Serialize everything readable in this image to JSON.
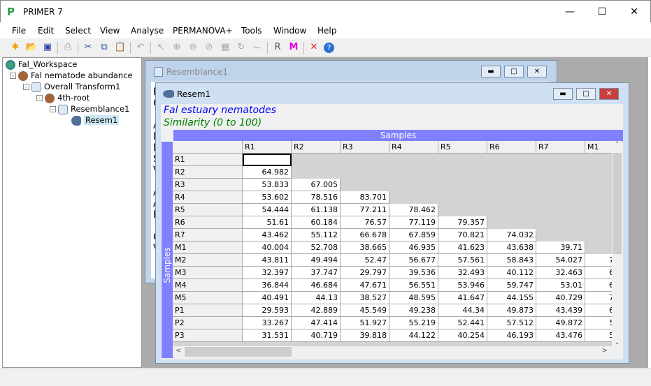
{
  "app": {
    "title": "PRIMER 7",
    "controls": [
      "minimize",
      "maximize",
      "close"
    ]
  },
  "menu": [
    "File",
    "Edit",
    "Select",
    "View",
    "Analyse",
    "PERMANOVA+",
    "Tools",
    "Window",
    "Help"
  ],
  "toolbar": [
    "new-icon",
    "open-icon",
    "save-icon",
    "print-icon",
    "cut-icon",
    "copy-icon",
    "paste-icon",
    "undo-icon",
    "pointer-icon",
    "zoom-in-icon",
    "zoom-out-icon",
    "zoom-reset-icon",
    "select-area-icon",
    "rotate-icon",
    "crop-icon",
    "matrix-r-icon",
    "matrix-m-icon",
    "delete-icon",
    "help-icon"
  ],
  "tree": [
    {
      "label": "Fal_Workspace",
      "icon": "globe-icon"
    },
    {
      "label": "Fal nematode abundance",
      "icon": "nematode-icon"
    },
    {
      "label": "Overall Transform1",
      "icon": "notepad-icon"
    },
    {
      "label": "4th-root",
      "icon": "nematode-icon"
    },
    {
      "label": "Resemblance1",
      "icon": "notepad-icon"
    },
    {
      "label": "Resem1",
      "icon": "fish-icon",
      "selected": true
    }
  ],
  "back_window": {
    "title": "Resemblance1",
    "edge_letters": [
      "R",
      "O",
      "A",
      "N",
      "D",
      "S",
      "V",
      "A",
      "A",
      "R",
      "C",
      "V"
    ]
  },
  "front_window": {
    "title": "Resem1",
    "heading1": "Fal estuary nematodes",
    "heading2": "Similarity (0 to 100)",
    "col_axis": "Samples",
    "row_axis": "Samples"
  },
  "colors": {
    "heading1": "#0000ff",
    "heading2": "#008000",
    "samples_band": "#8080ff"
  },
  "table": {
    "columns": [
      "R1",
      "R2",
      "R3",
      "R4",
      "R5",
      "R6",
      "R7",
      "M1"
    ],
    "rows": [
      {
        "label": "R1",
        "values": []
      },
      {
        "label": "R2",
        "values": [
          "64.982"
        ]
      },
      {
        "label": "R3",
        "values": [
          "53.833",
          "67.005"
        ]
      },
      {
        "label": "R4",
        "values": [
          "53.602",
          "78.516",
          "83.701"
        ]
      },
      {
        "label": "R5",
        "values": [
          "54.444",
          "61.138",
          "77.211",
          "78.462"
        ]
      },
      {
        "label": "R6",
        "values": [
          "51.61",
          "60.184",
          "76.57",
          "77.119",
          "79.357"
        ]
      },
      {
        "label": "R7",
        "values": [
          "43.462",
          "55.112",
          "66.678",
          "67.859",
          "70.821",
          "74.032"
        ]
      },
      {
        "label": "M1",
        "values": [
          "40.004",
          "52.708",
          "38.665",
          "46.935",
          "41.623",
          "43.638",
          "39.71"
        ]
      },
      {
        "label": "M2",
        "values": [
          "43.811",
          "49.494",
          "52.47",
          "56.677",
          "57.561",
          "58.843",
          "54.027",
          "7"
        ]
      },
      {
        "label": "M3",
        "values": [
          "32.397",
          "37.747",
          "29.797",
          "39.536",
          "32.493",
          "40.112",
          "32.463",
          "6"
        ]
      },
      {
        "label": "M4",
        "values": [
          "36.844",
          "46.684",
          "47.671",
          "56.551",
          "53.946",
          "59.747",
          "53.01",
          "6"
        ]
      },
      {
        "label": "M5",
        "values": [
          "40.491",
          "44.13",
          "38.527",
          "48.595",
          "41.647",
          "44.155",
          "40.729",
          "7"
        ]
      },
      {
        "label": "P1",
        "values": [
          "29.593",
          "42.889",
          "45.549",
          "49.238",
          "44.34",
          "49.873",
          "43.439",
          "6"
        ]
      },
      {
        "label": "P2",
        "values": [
          "33.267",
          "47.414",
          "51.927",
          "55.219",
          "52.441",
          "57.512",
          "49.872",
          "5"
        ]
      },
      {
        "label": "P3",
        "values": [
          "31.531",
          "40.719",
          "39.818",
          "44.122",
          "40.254",
          "46.193",
          "43.476",
          "5"
        ]
      }
    ]
  }
}
